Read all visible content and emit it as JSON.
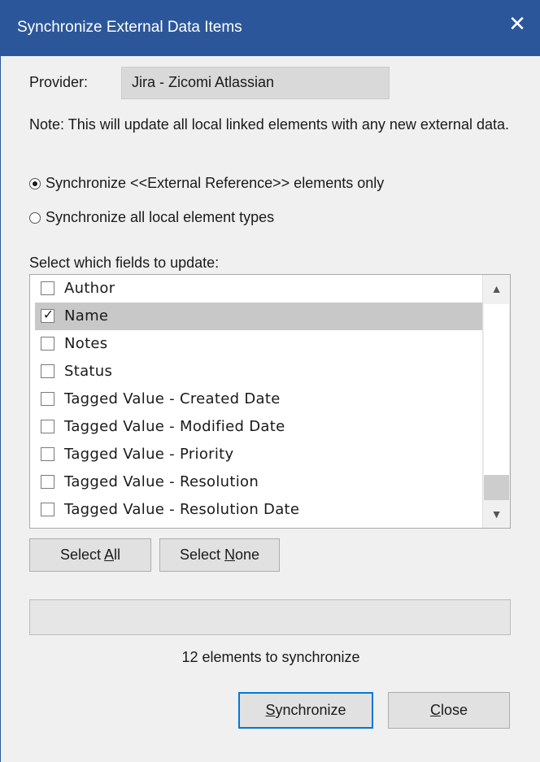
{
  "window": {
    "title": "Synchronize External Data Items",
    "close_glyph": "✕",
    "title_bar_color": "#2b579a"
  },
  "provider": {
    "label": "Provider:",
    "value": "Jira - Zicomi Atlassian"
  },
  "note": "Note: This will update all local linked elements with any new external data.",
  "sync_mode": {
    "options": [
      {
        "label": "Synchronize <<External Reference>> elements only",
        "selected": true
      },
      {
        "label": "Synchronize all local element types",
        "selected": false
      }
    ]
  },
  "fields": {
    "label": "Select which fields to update:",
    "items": [
      {
        "label": "Author",
        "checked": false
      },
      {
        "label": "Name",
        "checked": true
      },
      {
        "label": "Notes",
        "checked": false
      },
      {
        "label": "Status",
        "checked": false
      },
      {
        "label": "Tagged Value - Created Date",
        "checked": false
      },
      {
        "label": "Tagged Value - Modified Date",
        "checked": false
      },
      {
        "label": "Tagged Value - Priority",
        "checked": false
      },
      {
        "label": "Tagged Value - Resolution",
        "checked": false
      },
      {
        "label": "Tagged Value - Resolution Date",
        "checked": false
      }
    ],
    "scroll_up_glyph": "▲",
    "scroll_down_glyph": "▼"
  },
  "buttons": {
    "select_all": {
      "prefix": "Select ",
      "accel": "A",
      "suffix": "ll"
    },
    "select_none": {
      "prefix": "Select ",
      "accel": "N",
      "suffix": "one"
    },
    "synchronize": {
      "prefix": "",
      "accel": "S",
      "suffix": "ynchronize"
    },
    "close": {
      "prefix": "",
      "accel": "C",
      "suffix": "lose"
    }
  },
  "progress": {
    "fraction": 0
  },
  "status": "12 elements to synchronize",
  "check_glyph": "✓"
}
